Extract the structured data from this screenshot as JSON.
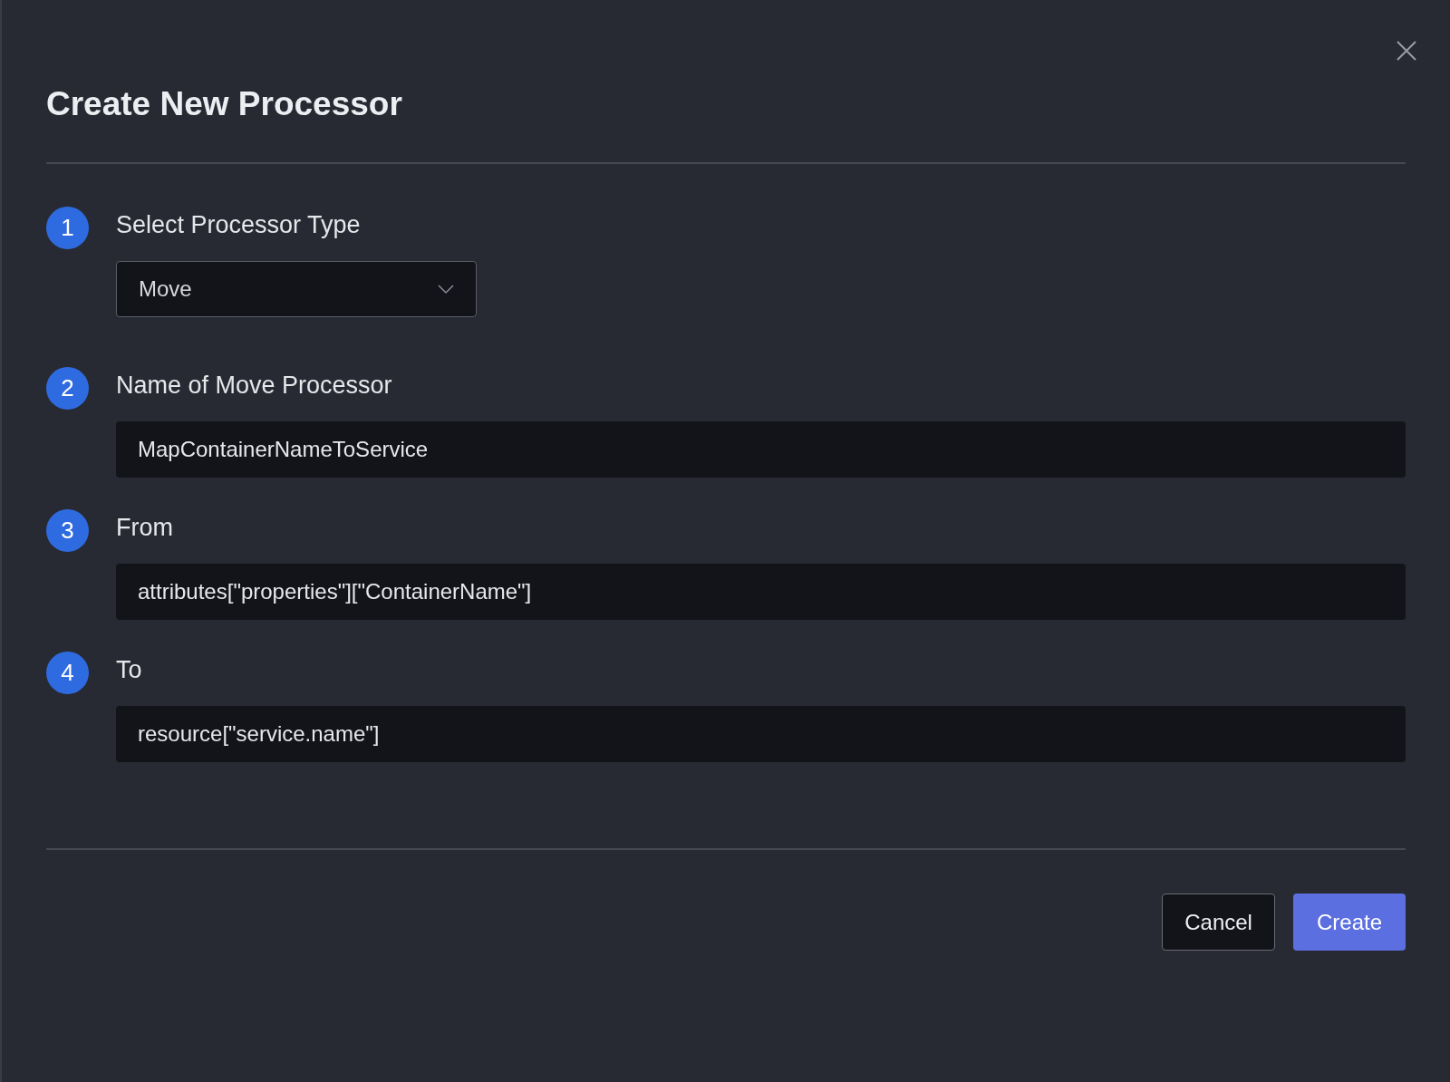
{
  "dialog": {
    "title": "Create New Processor"
  },
  "steps": [
    {
      "number": "1",
      "label": "Select Processor Type",
      "kind": "select",
      "value": "Move"
    },
    {
      "number": "2",
      "label": "Name of Move Processor",
      "kind": "text",
      "value": "MapContainerNameToService"
    },
    {
      "number": "3",
      "label": "From",
      "kind": "text",
      "value": "attributes[\"properties\"][\"ContainerName\"]"
    },
    {
      "number": "4",
      "label": "To",
      "kind": "text",
      "value": "resource[\"service.name\"]"
    }
  ],
  "buttons": [
    {
      "label": "Cancel",
      "kind": "secondary"
    },
    {
      "label": "Create",
      "kind": "primary"
    }
  ]
}
